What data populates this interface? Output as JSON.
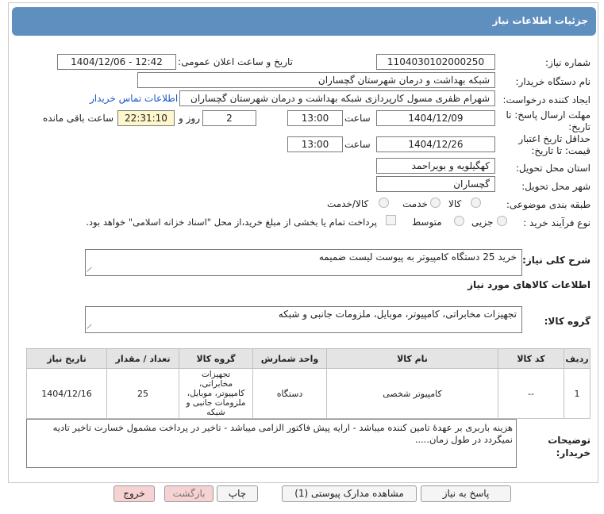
{
  "header": {
    "title": "جزئیات اطلاعات نیاز"
  },
  "fields": {
    "need_number_label": "شماره نیاز:",
    "need_number": "1104030102000250",
    "announce_label": "تاریخ و ساعت اعلان عمومی:",
    "announce_value": "1404/12/06 - 12:42",
    "buyer_org_label": "نام دستگاه خریدار:",
    "buyer_org": "شبکه بهداشت و درمان شهرستان گچساران",
    "creator_label": "ایجاد کننده درخواست:",
    "creator": "شهرام ظفری مسول کارپردازی  شبکه بهداشت و درمان شهرستان گچساران",
    "contact_link": "اطلاعات تماس خریدار",
    "reply_deadline_label_1": "مهلت ارسال پاسخ: تا",
    "reply_deadline_label_2": "تاریخ:",
    "reply_date": "1404/12/09",
    "time_label": "ساعت",
    "reply_time": "13:00",
    "days_value": "2",
    "days_label": "روز و",
    "remaining_time": "22:31:10",
    "remaining_label": "ساعت باقی مانده",
    "price_validity_label_1": "حداقل تاریخ اعتبار",
    "price_validity_label_2": "قیمت: تا تاریخ:",
    "validity_date": "1404/12/26",
    "validity_time": "13:00",
    "province_label": "استان محل تحویل:",
    "province": "کهگیلویه و بویراحمد",
    "city_label": "شهر محل تحویل:",
    "city": "گچساران",
    "category_label": "طبقه بندی موضوعی:",
    "category_options": [
      "کالا",
      "خدمت",
      "کالا/خدمت"
    ],
    "process_label": "نوع فرآیند خرید :",
    "process_options": [
      "جزیی",
      "متوسط"
    ],
    "payment_note": "پرداخت تمام یا بخشی از مبلغ خرید،از محل \"اسناد خزانه اسلامی\" خواهد بود."
  },
  "description": {
    "label": "شرح کلی نیاز:",
    "value": "خرید 25 دستگاه کامپیوتر به پیوست لیست ضمیمه"
  },
  "goods_section": {
    "title": "اطلاعات کالاهای مورد نیاز",
    "group_label": "گروه کالا:",
    "group_value": "تجهیزات مخابراتی، کامپیوتر، موبایل، ملزومات جانبی و شبکه"
  },
  "table": {
    "headers": [
      "ردیف",
      "کد کالا",
      "نام کالا",
      "واحد شمارش",
      "گروه کالا",
      "تعداد / مقدار",
      "تاریخ نیاز"
    ],
    "rows": [
      {
        "row": "1",
        "code": "--",
        "name": "کامپیوتر شخصی",
        "unit": "دستگاه",
        "group_lines": [
          "تجهیزات",
          "مخابراتی،",
          "کامپیوتر، موبایل،",
          "ملزومات جانبی و",
          "شبکه"
        ],
        "qty": "25",
        "date": "1404/12/16"
      }
    ]
  },
  "buyer_notes": {
    "label_1": "توضیحات",
    "label_2": "خریدار:",
    "line_1": "هزینه باربری بر عهدۀ تامین کننده میباشد - ارایه پیش فاکتور الزامی میباشد - تاخیر در پرداخت مشمول خسارت تاخیر تادیه",
    "line_2": "نمیگردد در طول زمان....."
  },
  "buttons": {
    "reply": "پاسخ به نیاز",
    "view_docs": "مشاهده مدارک پیوستی (1)",
    "print": "چاپ",
    "back": "بازگشت",
    "exit": "خروج"
  },
  "colors": {
    "header": "#5e8fbf",
    "remaining_bg": "#fff7cc",
    "link": "#1a56c4"
  }
}
